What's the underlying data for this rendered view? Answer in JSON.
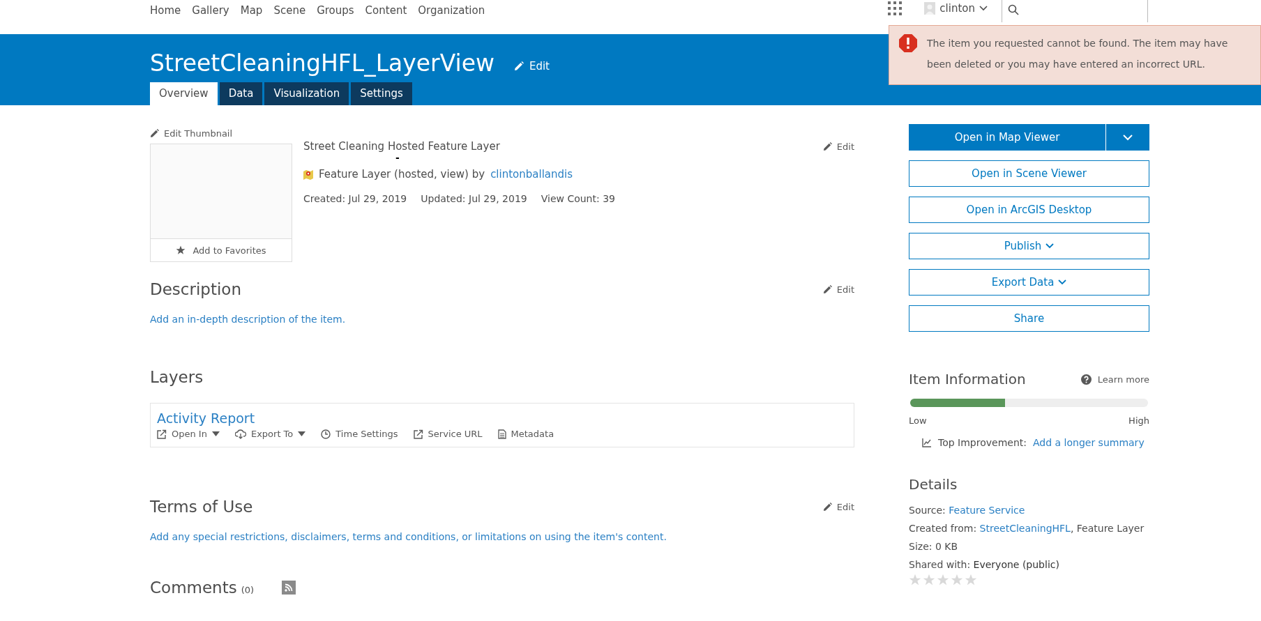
{
  "nav": {
    "items": [
      "Home",
      "Gallery",
      "Map",
      "Scene",
      "Groups",
      "Content",
      "Organization"
    ],
    "user": "clinton"
  },
  "alert": {
    "message": "The item you requested cannot be found. The item may have been deleted or you may have entered an incorrect URL."
  },
  "header": {
    "title": "StreetCleaningHFL_LayerView",
    "edit": "Edit",
    "tabs": [
      {
        "label": "Overview",
        "selected": true
      },
      {
        "label": "Data",
        "selected": false
      },
      {
        "label": "Visualization",
        "selected": false
      },
      {
        "label": "Settings",
        "selected": false
      }
    ]
  },
  "thumbnail": {
    "edit_label": "Edit Thumbnail",
    "favorite_label": "Add to Favorites"
  },
  "summary": {
    "title": "Street Cleaning Hosted Feature Layer",
    "subtitle": "-",
    "type": "Feature Layer (hosted, view) by",
    "owner": "clintonballandis",
    "meta": [
      "Created: Jul 29, 2019",
      "Updated: Jul 29, 2019",
      "View Count: 39"
    ],
    "edit": "Edit"
  },
  "description": {
    "heading": "Description",
    "edit": "Edit",
    "link": "Add an in-depth description of the item."
  },
  "layers": {
    "heading": "Layers",
    "items": [
      {
        "name": "Activity Report",
        "actions": [
          {
            "label": "Open In",
            "kind": "open",
            "dropdown": true
          },
          {
            "label": "Export To",
            "kind": "export",
            "dropdown": true
          },
          {
            "label": "Time Settings",
            "kind": "time",
            "dropdown": false
          },
          {
            "label": "Service URL",
            "kind": "open",
            "dropdown": false
          },
          {
            "label": "Metadata",
            "kind": "document",
            "dropdown": false
          }
        ]
      }
    ]
  },
  "terms": {
    "heading": "Terms of Use",
    "edit": "Edit",
    "link": "Add any special restrictions, disclaimers, terms and conditions, or limitations on using the item's content."
  },
  "comments": {
    "heading": "Comments",
    "count": "(0)"
  },
  "actions": [
    {
      "label": "Open in Map Viewer",
      "kind": "primary"
    },
    {
      "label": "Open in Scene Viewer",
      "kind": "plain"
    },
    {
      "label": "Open in ArcGIS Desktop",
      "kind": "plain"
    },
    {
      "label": "Publish",
      "kind": "dropdown"
    },
    {
      "label": "Export Data",
      "kind": "dropdown"
    },
    {
      "label": "Share",
      "kind": "plain"
    }
  ],
  "item_information": {
    "heading": "Item Information",
    "learn_more": "Learn more",
    "level": 0.4,
    "low": "Low",
    "high": "High",
    "improvement_label": "Top Improvement:",
    "improvement_link": "Add a longer summary"
  },
  "details": {
    "heading": "Details",
    "rows": [
      {
        "label": "Source:",
        "value": "Feature Service",
        "suffix": "",
        "kind": "link"
      },
      {
        "label": "Created from:",
        "value": "StreetCleaningHFL",
        "suffix": ", Feature Layer",
        "kind": "link"
      },
      {
        "label": "Size:",
        "value": "0 KB",
        "suffix": "",
        "kind": "text"
      },
      {
        "label": "Shared with:",
        "value": "Everyone (public)",
        "suffix": "",
        "kind": "strong"
      }
    ],
    "stars": 0
  }
}
